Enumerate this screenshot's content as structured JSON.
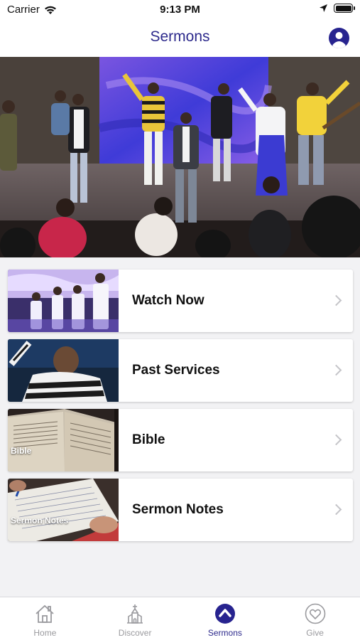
{
  "status_bar": {
    "carrier": "Carrier",
    "time": "9:13 PM",
    "battery_level": 1.0
  },
  "nav": {
    "title": "Sermons",
    "profile_icon": "person-circle-icon"
  },
  "hero": {
    "image": "worship-stage-photo"
  },
  "items": [
    {
      "label": "Watch Now",
      "thumb_label": "",
      "thumb": "choir-photo"
    },
    {
      "label": "Past Services",
      "thumb_label": "",
      "thumb": "preacher-photo"
    },
    {
      "label": "Bible",
      "thumb_label": "Bible",
      "thumb": "bible-photo"
    },
    {
      "label": "Sermon Notes",
      "thumb_label": "Sermon Notes",
      "thumb": "notes-photo"
    }
  ],
  "tabs": [
    {
      "label": "Home",
      "icon": "house-icon",
      "active": false
    },
    {
      "label": "Discover",
      "icon": "church-icon",
      "active": false
    },
    {
      "label": "Sermons",
      "icon": "chevron-up-circle-icon",
      "active": true
    },
    {
      "label": "Give",
      "icon": "heart-circle-icon",
      "active": false
    }
  ],
  "colors": {
    "accent": "#2d2a8c",
    "inactive_tab": "#9a9a9e",
    "background": "#f2f2f4"
  }
}
